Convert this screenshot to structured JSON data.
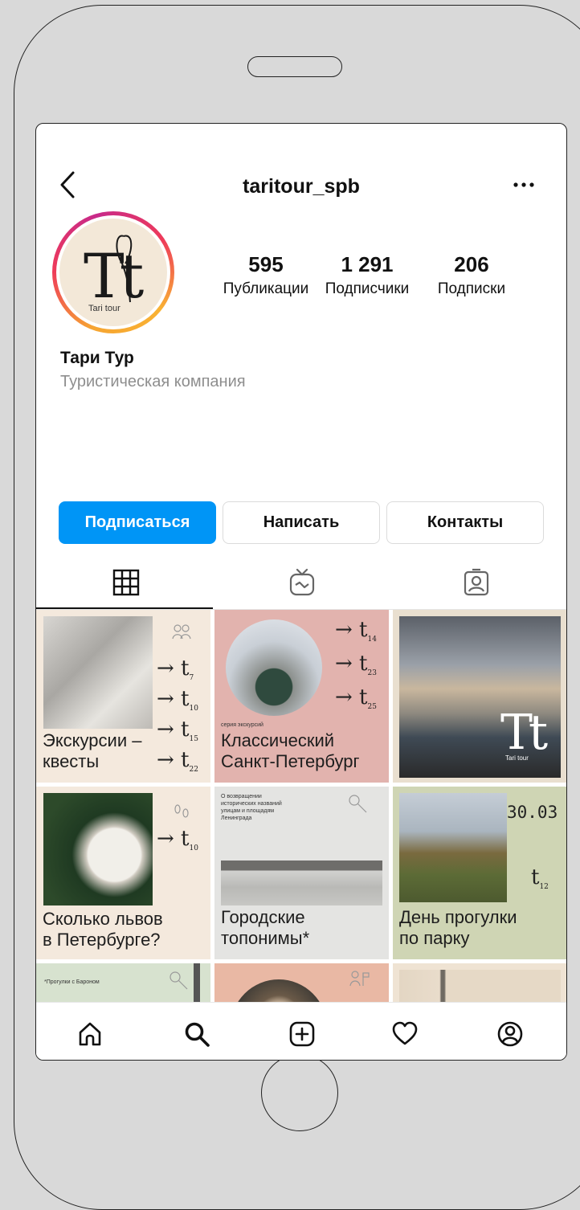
{
  "header": {
    "username": "taritour_spb"
  },
  "profile": {
    "avatar_text": "Tt",
    "avatar_subtext": "Tari tour",
    "stats": [
      {
        "value": "595",
        "label": "Публикации"
      },
      {
        "value": "1 291",
        "label": "Подписчики"
      },
      {
        "value": "206",
        "label": "Подписки"
      }
    ],
    "name": "Тари Тур",
    "category": "Туристическая компания"
  },
  "buttons": {
    "follow": "Подписаться",
    "message": "Написать",
    "contacts": "Контакты"
  },
  "posts": [
    {
      "caption_line1": "Экскурсии –",
      "caption_line2": "квесты",
      "nums": [
        "7",
        "10",
        "15",
        "22"
      ]
    },
    {
      "small": "серия экскурсий",
      "caption_line1": "Классический",
      "caption_line2": "Санкт-Петербург",
      "nums": [
        "14",
        "23",
        "25"
      ]
    },
    {
      "overlay": "Tt",
      "overlay_sub": "Tari tour"
    },
    {
      "caption_line1": "Сколько львов",
      "caption_line2": "в Петербурге?",
      "nums": [
        "10"
      ]
    },
    {
      "small_lines": [
        "О возвращении",
        "исторических названий",
        "улицам и площадям",
        "Ленинграда"
      ],
      "caption_line1": "Городские",
      "caption_line2": "топонимы*"
    },
    {
      "date": "30.03",
      "num": "12",
      "caption_line1": "День прогулки",
      "caption_line2": "по парку"
    },
    {
      "small": "*Прогулки с Бароном"
    },
    {},
    {}
  ],
  "colors": {
    "accent": "#0095f6",
    "tile_beige": "#f4e9dd",
    "tile_pink": "#e2b3ae",
    "tile_green": "#cfd5b4",
    "tile_gray": "#e4e4e2"
  }
}
